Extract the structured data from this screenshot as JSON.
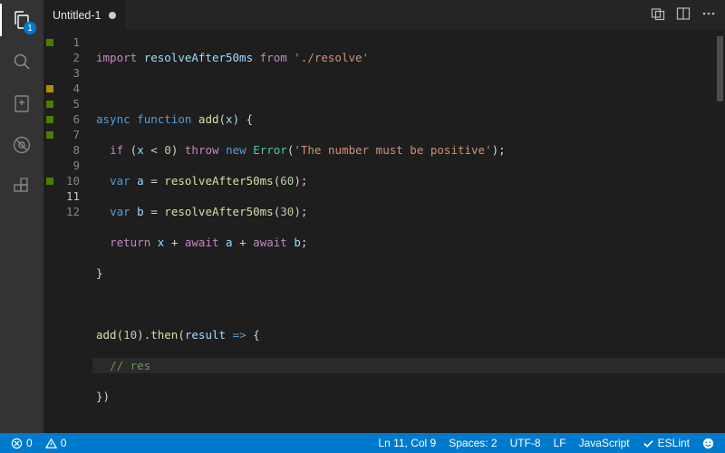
{
  "activitybar": {
    "explorer_badge": "1"
  },
  "tab": {
    "title": "Untitled-1"
  },
  "gutter_marks": [
    "green",
    "",
    "",
    "yellow",
    "green",
    "green",
    "green",
    "",
    "",
    "green",
    "",
    ""
  ],
  "line_numbers": [
    "1",
    "2",
    "3",
    "4",
    "5",
    "6",
    "7",
    "8",
    "9",
    "10",
    "11",
    "12"
  ],
  "current_line_index": 10,
  "code": {
    "l1": {
      "import": "import",
      "name": "resolveAfter50ms",
      "from": "from",
      "path": "'./resolve'"
    },
    "l3": {
      "async": "async",
      "function": "function",
      "name": "add",
      "param": "x"
    },
    "l4": {
      "if": "if",
      "cond_var": "x",
      "op": "<",
      "zero": "0",
      "throw": "throw",
      "new": "new",
      "err": "Error",
      "msg": "'The number must be positive'"
    },
    "l5": {
      "var": "var",
      "name": "a",
      "fn": "resolveAfter50ms",
      "arg": "60"
    },
    "l6": {
      "var": "var",
      "name": "b",
      "fn": "resolveAfter50ms",
      "arg": "30"
    },
    "l7": {
      "return": "return",
      "x": "x",
      "await1": "await",
      "a": "a",
      "await2": "await",
      "b": "b"
    },
    "l10": {
      "fn": "add",
      "arg": "10",
      "then": "then",
      "param": "result"
    },
    "l11": {
      "comment": "// res"
    }
  },
  "status": {
    "errors": "0",
    "warnings": "0",
    "lncol": "Ln 11, Col 9",
    "spaces": "Spaces: 2",
    "encoding": "UTF-8",
    "eol": "LF",
    "lang": "JavaScript",
    "eslint": "ESLint"
  }
}
